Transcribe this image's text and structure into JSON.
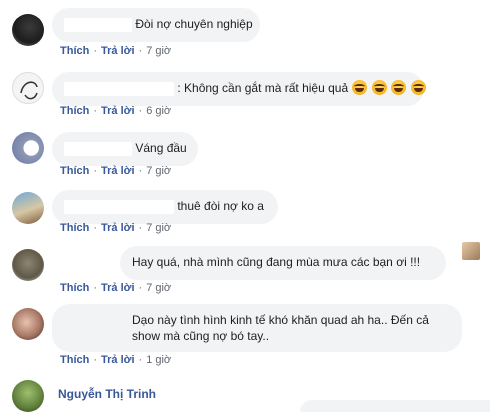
{
  "actions": {
    "like": "Thích",
    "reply": "Trả lời",
    "separator": "·"
  },
  "comments": [
    {
      "text": "Đòi nợ chuyên nghiệp",
      "time": "7 giờ"
    },
    {
      "text": ": Không cần gắt mà rất hiệu quả",
      "time": "6 giờ",
      "emoji": [
        "laughing-emoji",
        "laughing-emoji",
        "laughing-emoji",
        "laughing-emoji"
      ]
    },
    {
      "text": "Váng đầu",
      "time": "7 giờ"
    },
    {
      "text": "thuê đòi nợ ko a",
      "time": "7 giờ"
    },
    {
      "text": "Hay quá, nhà mình cũng đang mùa mưa các bạn ơi !!!",
      "time": "7 giờ"
    },
    {
      "text": "Dạo này tình hình kinh tế khó khăn quad ah ha.. Đến cả show mà cũng nợ bó tay..",
      "time": "1 giờ"
    },
    {
      "name": "Nguyễn Thị Trinh"
    }
  ],
  "colors": {
    "link": "#385898",
    "bubble": "#f2f3f5",
    "meta": "#606770"
  }
}
